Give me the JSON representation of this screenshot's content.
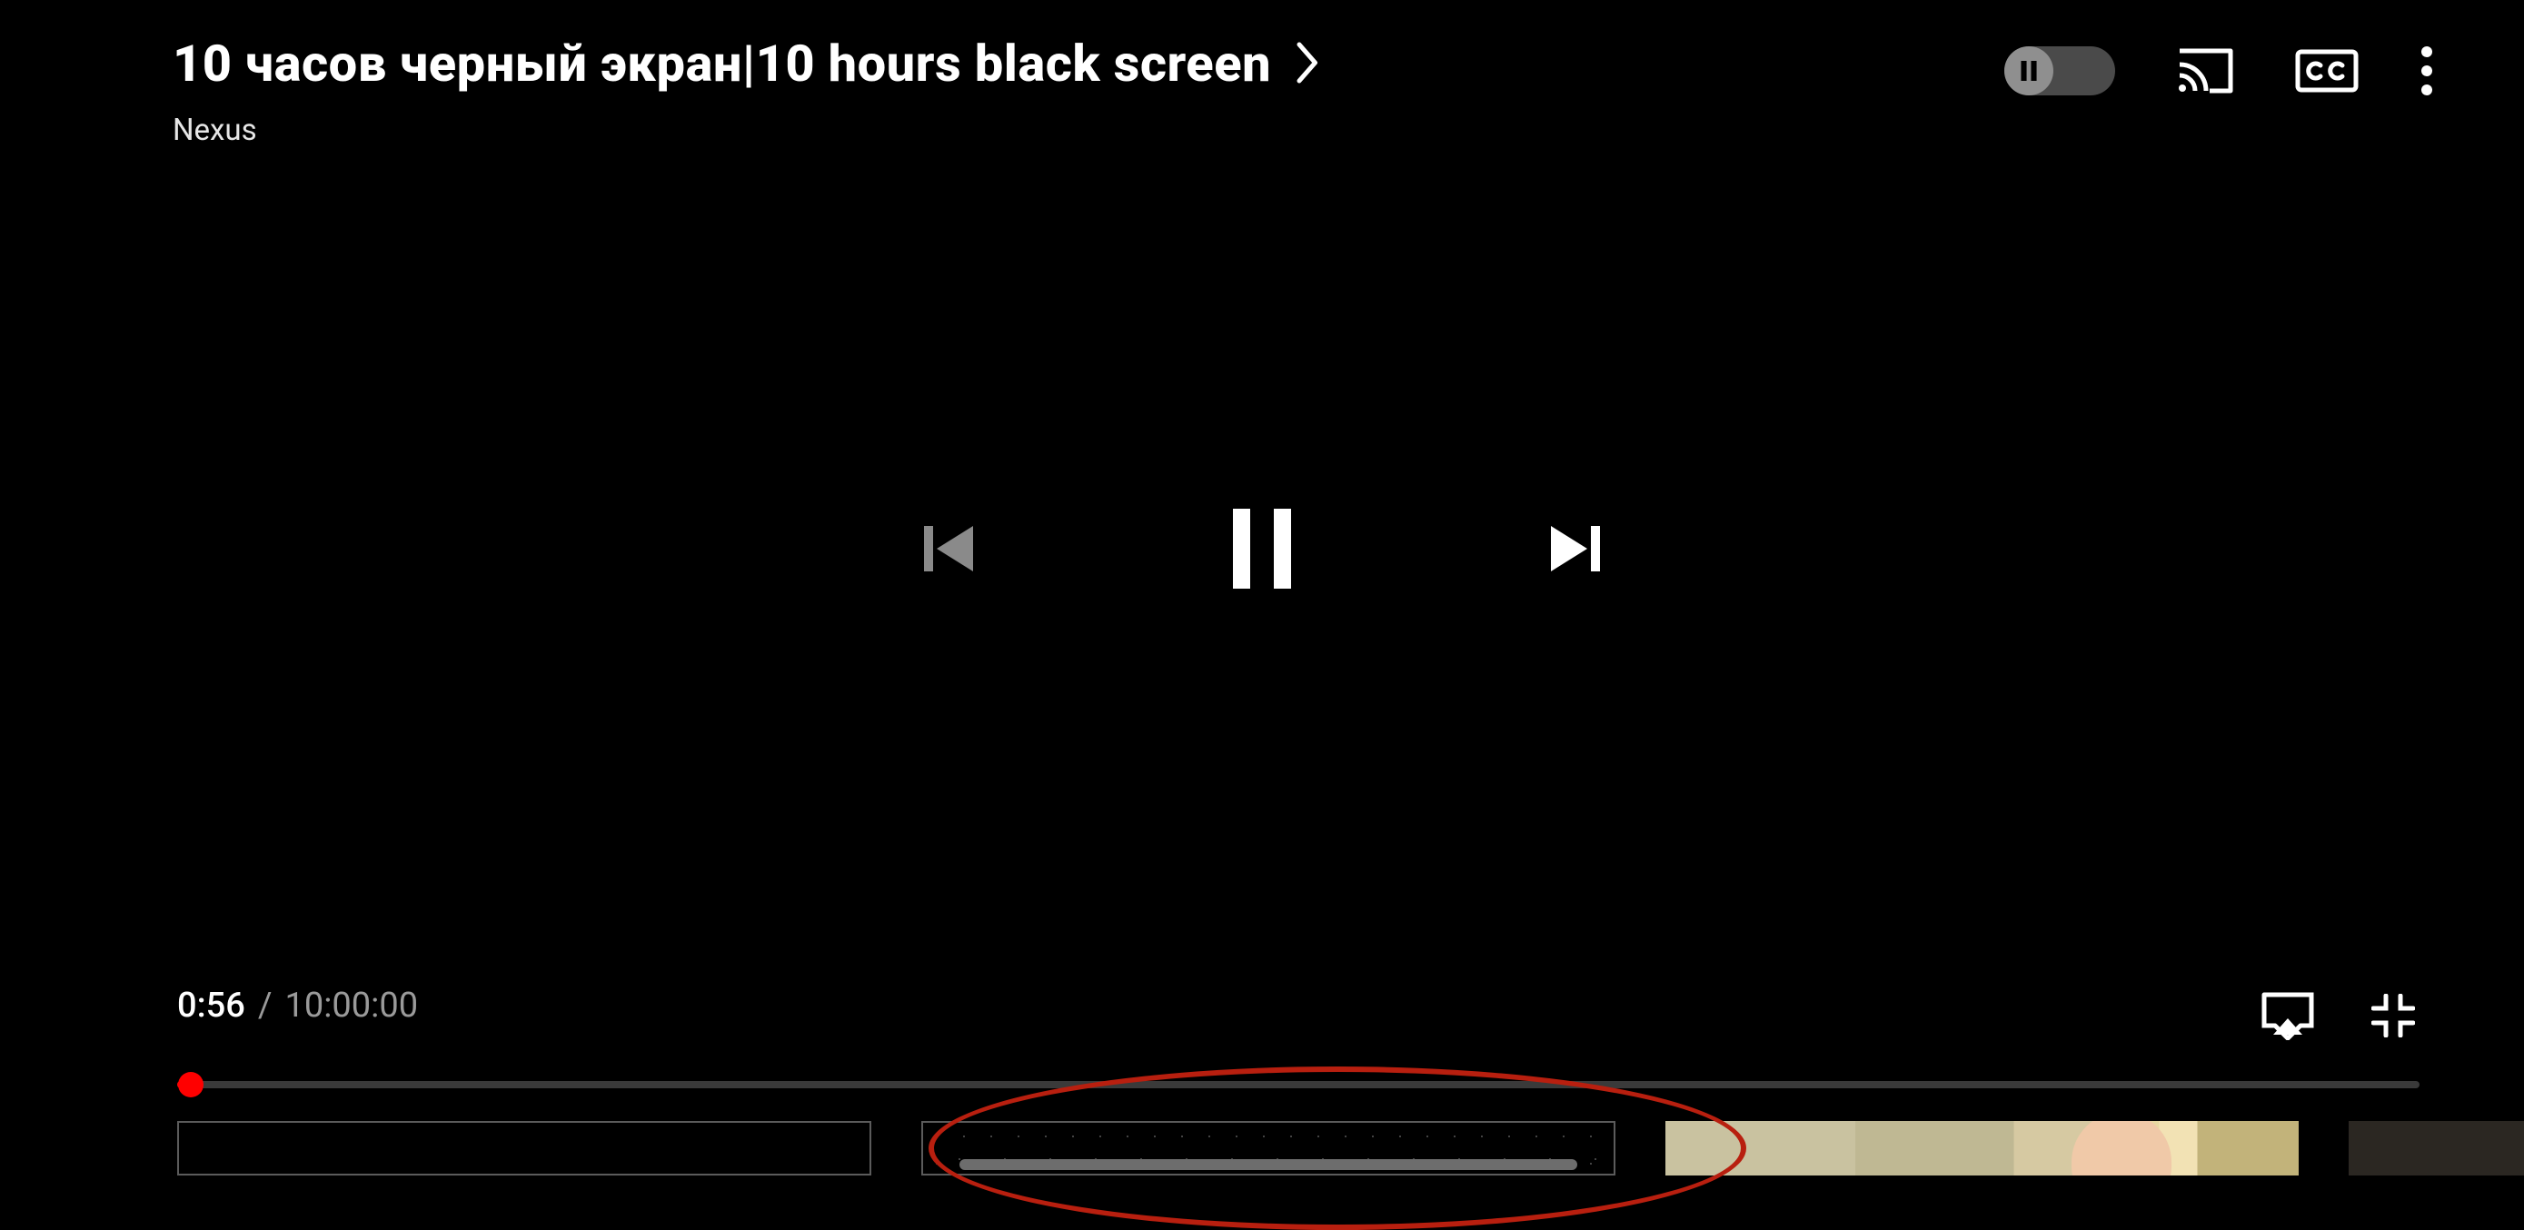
{
  "header": {
    "title": "10 часов черный экран|10 hours black screen",
    "channel": "Nexus"
  },
  "controls": {
    "autoplay_state": "paused",
    "cc_label": "CC"
  },
  "playback": {
    "current_time": "0:56",
    "total_time": "10:00:00",
    "separator": "/",
    "progress_percent": 0.15
  },
  "colors": {
    "accent": "#ff0000",
    "background": "#000000",
    "text": "#ffffff",
    "muted": "#9a9a9a",
    "annotation": "#b81f0f"
  }
}
